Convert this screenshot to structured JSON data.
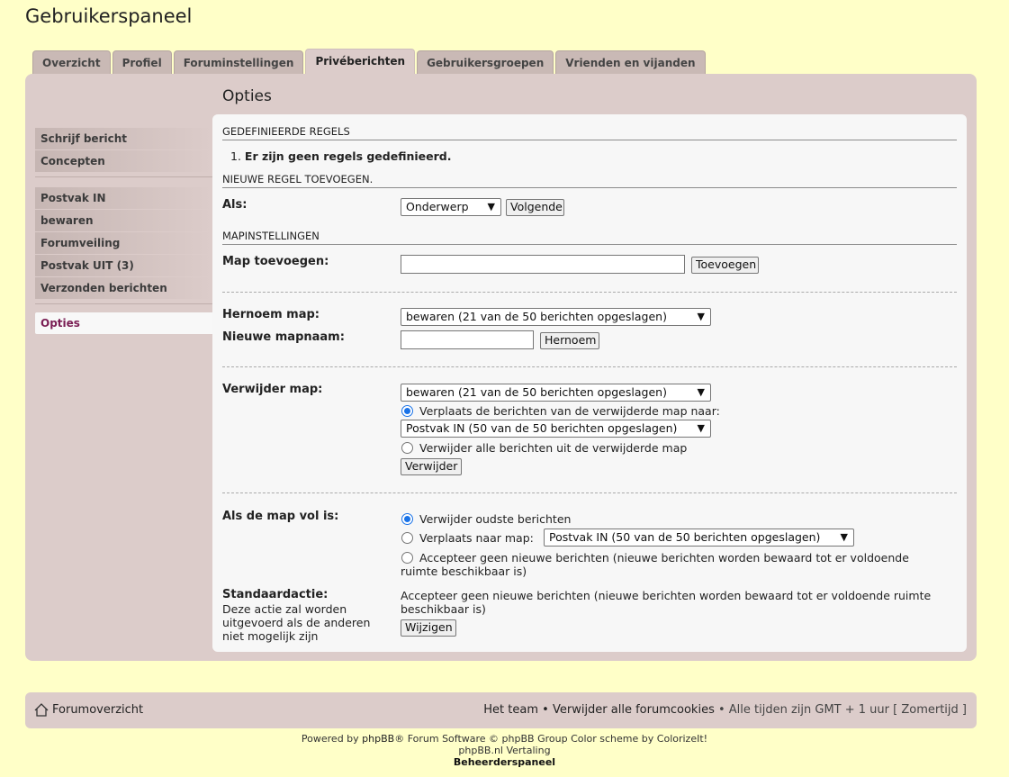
{
  "page_title": "Gebruikerspaneel",
  "tabs": [
    "Overzicht",
    "Profiel",
    "Foruminstellingen",
    "Privéberichten",
    "Gebruikersgroepen",
    "Vrienden en vijanden"
  ],
  "active_tab": "Privéberichten",
  "section_title": "Opties",
  "sidebar": {
    "group1": [
      "Schrijf bericht",
      "Concepten"
    ],
    "group2": [
      "Postvak IN",
      "bewaren",
      "Forumveiling",
      "Postvak UIT (3)",
      "Verzonden berichten"
    ],
    "active": "Opties"
  },
  "defined_rules": {
    "heading": "GEDEFINIEERDE REGELS",
    "item": "Er zijn geen regels gedefinieerd."
  },
  "new_rule": {
    "heading": "NIEUWE REGEL TOEVOEGEN.",
    "label": "Als:",
    "select_value": "Onderwerp",
    "button": "Volgende"
  },
  "folder_settings": {
    "heading": "MAPINSTELLINGEN",
    "add_label": "Map toevoegen:",
    "add_button": "Toevoegen",
    "rename_label": "Hernoem map:",
    "rename_select": "bewaren (21 van de 50 berichten opgeslagen)",
    "new_name_label": "Nieuwe mapnaam:",
    "rename_button": "Hernoem",
    "delete_label": "Verwijder map:",
    "delete_select": "bewaren (21 van de 50 berichten opgeslagen)",
    "move_radio": "Verplaats de berichten van de verwijderde map naar:",
    "move_select": "Postvak IN (50 van de 50 berichten opgeslagen)",
    "delete_all_radio": "Verwijder alle berichten uit de verwijderde map",
    "delete_button": "Verwijder"
  },
  "full_folder": {
    "label": "Als de map vol is:",
    "opt1": "Verwijder oudste berichten",
    "opt2": "Verplaats naar map:",
    "opt2_select": "Postvak IN (50 van de 50 berichten opgeslagen)",
    "opt3": "Accepteer geen nieuwe berichten (nieuwe berichten worden bewaard tot er voldoende ruimte beschikbaar is)",
    "default_label": "Standaardactie:",
    "default_desc": "Deze actie zal worden uitgevoerd als de anderen niet mogelijk zijn",
    "default_value": "Accepteer geen nieuwe berichten (nieuwe berichten worden bewaard tot er voldoende ruimte beschikbaar is)",
    "change_button": "Wijzigen"
  },
  "footer": {
    "home": "Forumoverzicht",
    "team": "Het team",
    "sep": "•",
    "cookies": "Verwijder alle forumcookies",
    "timezone": "• Alle tijden zijn GMT + 1 uur [ Zomertijd ]"
  },
  "credits": {
    "powered": "Powered by",
    "phpbb": "phpBB",
    "rest": "® Forum Software © phpBB Group Color scheme by",
    "colorizeit": "ColorizeIt!",
    "translation": "phpBB.nl Vertaling",
    "admin": "Beheerderspaneel"
  }
}
